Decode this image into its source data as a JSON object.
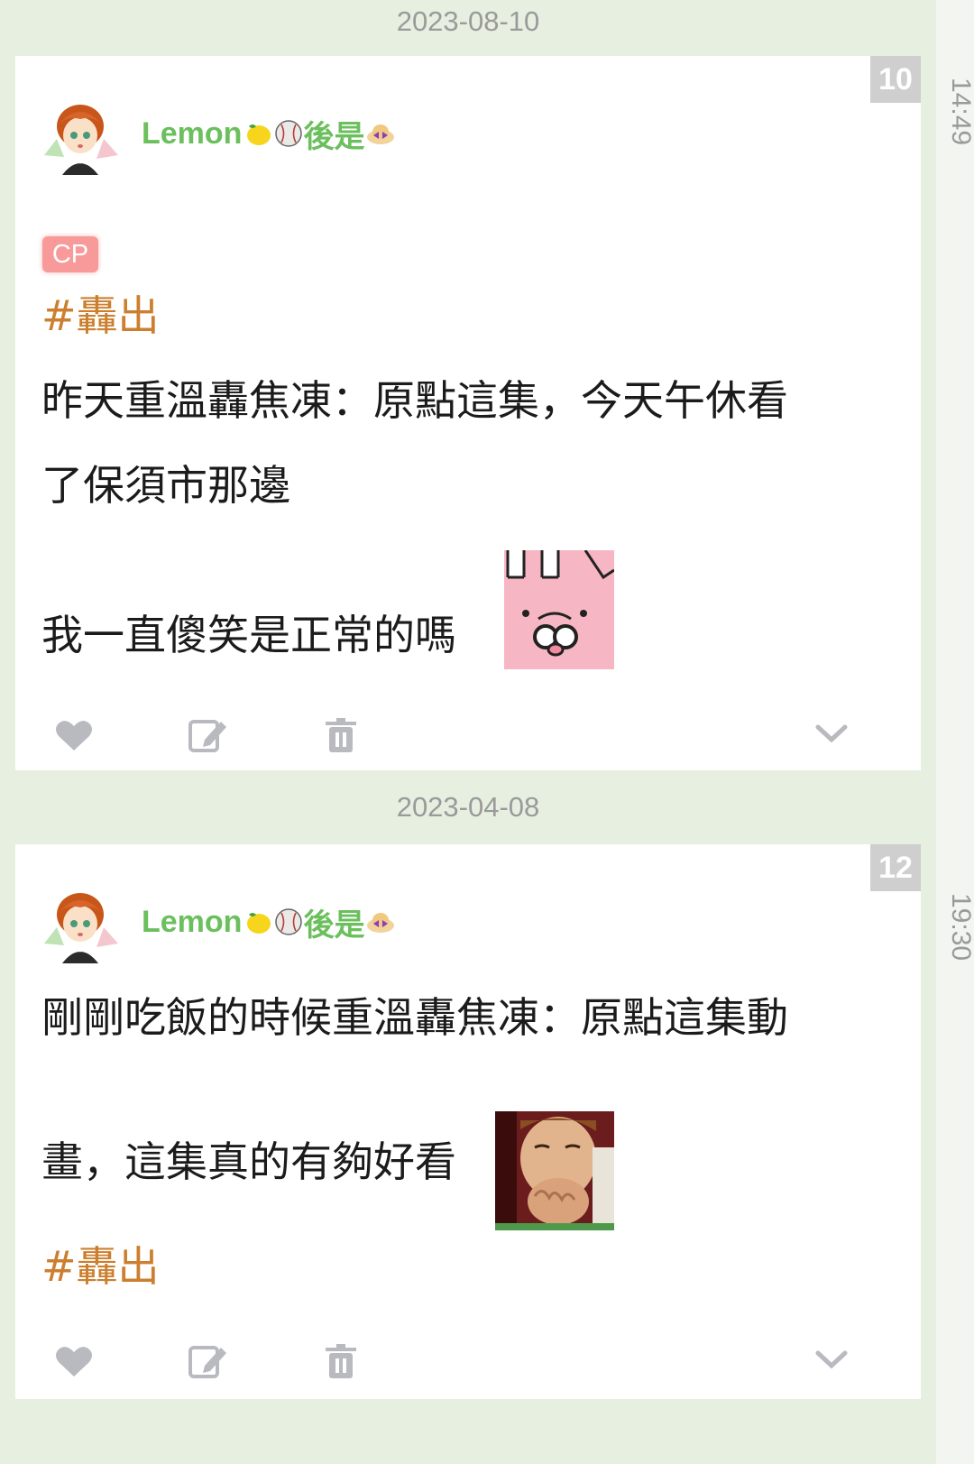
{
  "posts": [
    {
      "date": "2023-08-10",
      "time": "14:49",
      "count": "10",
      "author": "Lemon",
      "author_suffix": "後是",
      "tag": "CP",
      "hashtag": "#轟出",
      "lines": [
        "昨天重溫轟焦凍：原點這集，今天午休看",
        "了保須市那邊",
        "我一直傻笑是正常的嗎"
      ],
      "sticker": "pink-bunny-sticker"
    },
    {
      "date": "2023-04-08",
      "time": "19:30",
      "count": "12",
      "author": "Lemon",
      "author_suffix": "後是",
      "hashtag": "#轟出",
      "lines": [
        "剛剛吃飯的時候重溫轟焦凍：原點這集動",
        "畫，這集真的有夠好看"
      ],
      "sticker": "laughing-face-photo"
    }
  ],
  "icons": {
    "like": "heart-icon",
    "edit": "edit-icon",
    "delete": "trash-icon",
    "more": "chevron-down-icon"
  },
  "colors": {
    "author": "#6bbf5d",
    "hashtag": "#cc7f2e",
    "badge": "#cfcfcf",
    "tag": "#f89a9a",
    "background": "#e6efe0"
  }
}
